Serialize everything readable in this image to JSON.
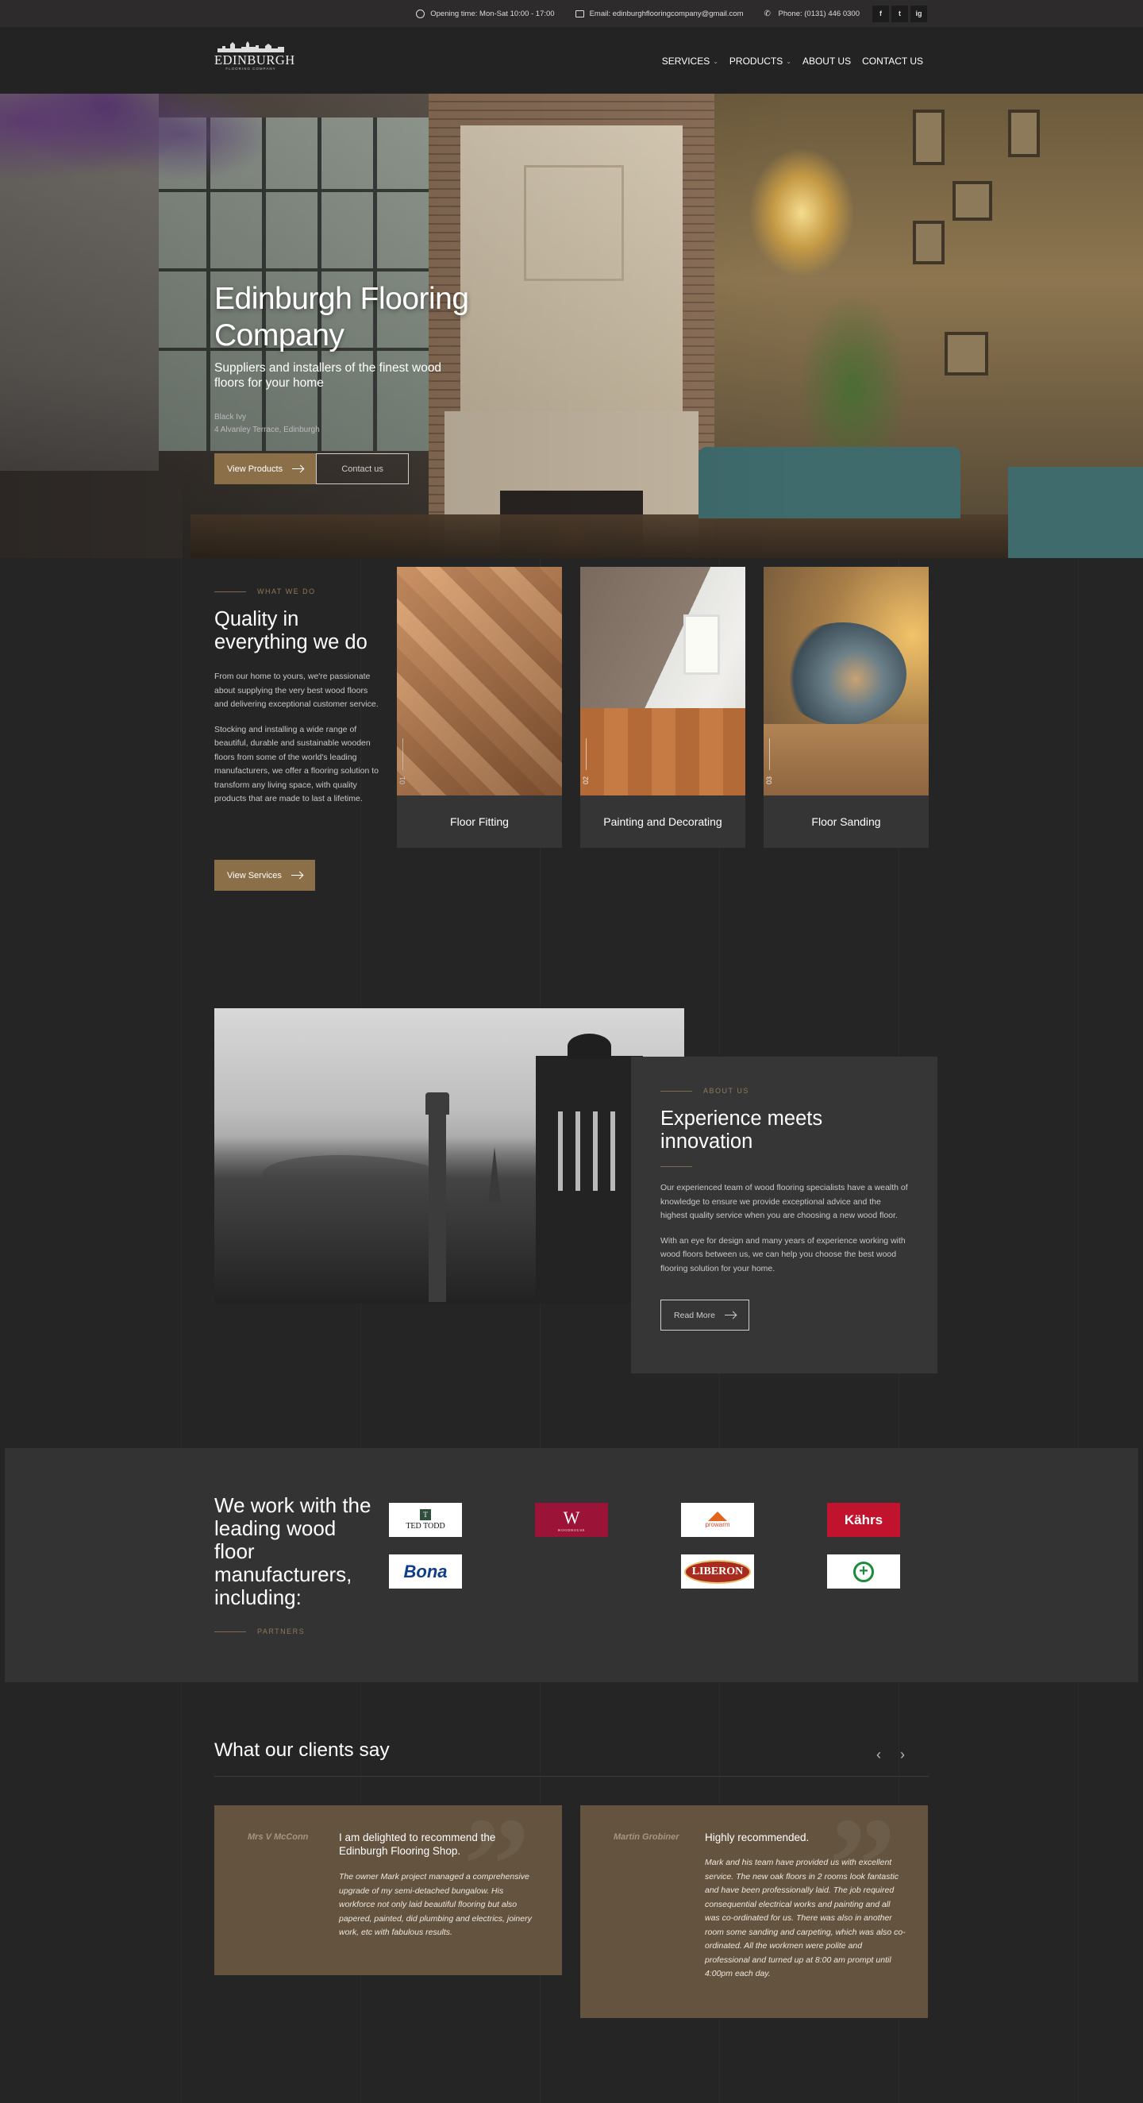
{
  "topbar": {
    "hours": "Opening time: Mon-Sat 10:00 - 17:00",
    "email": "Email: edinburghflooringcompany@gmail.com",
    "phone": "Phone: (0131) 446 0300",
    "social": [
      "f",
      "t",
      "ig"
    ]
  },
  "header": {
    "logo_word": "EDINBURGH",
    "logo_sub": "FLOORING COMPANY",
    "nav": [
      {
        "label": "SERVICES",
        "has_dropdown": true
      },
      {
        "label": "PRODUCTS",
        "has_dropdown": true
      },
      {
        "label": "ABOUT US",
        "has_dropdown": false
      },
      {
        "label": "CONTACT US",
        "has_dropdown": false
      }
    ]
  },
  "hero": {
    "title_line1": "Edinburgh Flooring",
    "title_line2": "Company",
    "subtitle": "Suppliers and installers of the finest wood floors for your home",
    "address_line1": "Black Ivy",
    "address_line2": "4 Alvanley Terrace, Edinburgh",
    "primary_button": "View Products",
    "secondary_button": "Contact us"
  },
  "services": {
    "eyebrow": "WHAT WE DO",
    "title": "Quality in everything we do",
    "para1": "From our home to yours, we're passionate about supplying the very best wood floors and delivering exceptional customer service.",
    "para2": "Stocking and installing a wide range of beautiful, durable and sustainable wooden floors from some of the world's leading manufacturers, we offer a flooring solution to transform any living space, with quality products that are made to last a lifetime.",
    "button": "View Services",
    "cards": [
      {
        "num": "01",
        "label": "Floor Fitting"
      },
      {
        "num": "02",
        "label": "Painting and Decorating"
      },
      {
        "num": "03",
        "label": "Floor Sanding"
      }
    ]
  },
  "about": {
    "eyebrow": "ABOUT US",
    "title": "Experience meets innovation",
    "para1": "Our experienced team of wood flooring specialists have a wealth of knowledge to ensure we provide exceptional advice and the highest quality service when you are choosing a new wood floor.",
    "para2": "With an eye for design and many years of experience working with wood floors between us, we can help you choose the best wood flooring solution for your home.",
    "button": "Read More"
  },
  "partners": {
    "title": "We work with the leading wood floor manufacturers, including:",
    "eyebrow": "PARTNERS",
    "logos": {
      "tedtodd": "TED TODD",
      "tedtodd_mark": "T",
      "woodhouse_mark": "W",
      "woodhouse_sub": "WOODHOUSE",
      "prowarm": "prowarm",
      "kahrs": "Kährs",
      "bona": "Bona",
      "liberon": "LIBERON",
      "plus": "+"
    }
  },
  "testimonials": {
    "title": "What our clients say",
    "prev": "‹",
    "next": "›",
    "items": [
      {
        "name": "Mrs V McConn",
        "headline": "I am delighted to recommend the Edinburgh Flooring Shop.",
        "body": "The owner Mark project managed a comprehensive upgrade of my semi-detached bungalow. His workforce not only laid beautiful flooring but also papered, painted, did plumbing and electrics, joinery work, etc with fabulous results."
      },
      {
        "name": "Martin Grobiner",
        "headline": "Highly recommended.",
        "body": "Mark and his team have provided us with excellent service. The new oak floors in 2 rooms look fantastic and have been professionally laid. The job required consequential electrical works and painting and all was co-ordinated for us. There was also in another room some sanding and carpeting, which was also co-ordinated. All the workmen were polite and professional and turned up at 8:00 am prompt until 4:00pm each day."
      }
    ]
  },
  "colors": {
    "background": "#252525",
    "accent_gold": "#8a6f48",
    "card": "#353535",
    "testimonial_card": "#63533f"
  }
}
